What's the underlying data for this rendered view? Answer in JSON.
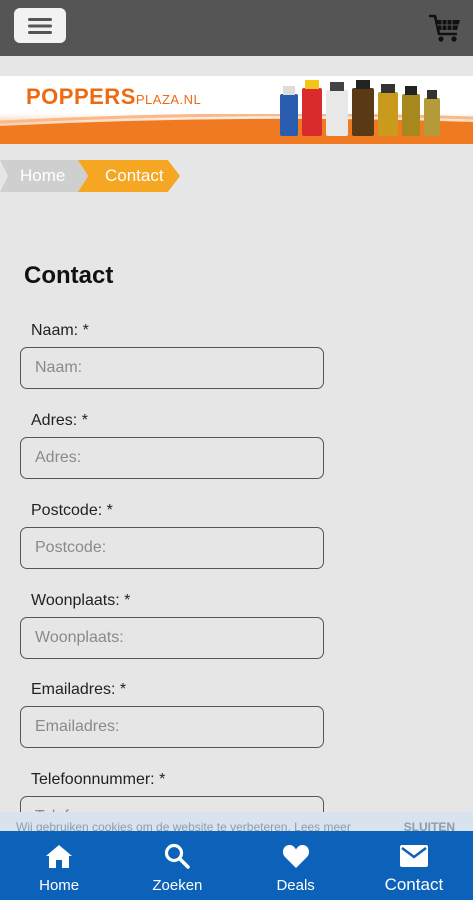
{
  "header": {
    "menu_icon": "hamburger-icon",
    "cart_icon": "shopping-cart-icon"
  },
  "banner": {
    "logo_main": "POPPERS",
    "logo_small": "PLAZA.NL"
  },
  "breadcrumb": {
    "home": "Home",
    "current": "Contact"
  },
  "page": {
    "title": "Contact"
  },
  "form": {
    "fields": [
      {
        "label": "Naam: *",
        "placeholder": "Naam:"
      },
      {
        "label": "Adres: *",
        "placeholder": "Adres:"
      },
      {
        "label": "Postcode: *",
        "placeholder": "Postcode:"
      },
      {
        "label": "Woonplaats: *",
        "placeholder": "Woonplaats:"
      },
      {
        "label": "Emailadres: *",
        "placeholder": "Emailadres:"
      },
      {
        "label": "Telefoonnummer: *",
        "placeholder": "Telefoonnummer:"
      }
    ]
  },
  "cookie": {
    "text": "Wij gebruiken cookies om de website te verbeteren. Lees meer",
    "close": "SLUITEN"
  },
  "nav": {
    "items": [
      {
        "label": "Home",
        "icon": "home-icon"
      },
      {
        "label": "Zoeken",
        "icon": "search-icon"
      },
      {
        "label": "Deals",
        "icon": "heart-icon"
      },
      {
        "label": "Contact",
        "icon": "mail-icon"
      }
    ]
  },
  "colors": {
    "topbar": "#555555",
    "accent": "#f5a623",
    "nav": "#0c62b8",
    "brand_orange": "#ee6a12"
  }
}
